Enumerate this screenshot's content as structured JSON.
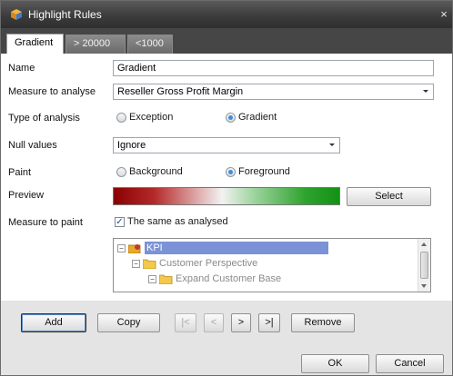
{
  "window": {
    "title": "Highlight Rules",
    "close_glyph": "×",
    "icon": "app-cube-icon"
  },
  "tabs": [
    {
      "label": "Gradient",
      "active": true
    },
    {
      "label": "> 20000",
      "active": false
    },
    {
      "label": "<1000",
      "active": false
    }
  ],
  "form": {
    "name_label": "Name",
    "name_value": "Gradient",
    "measure_label": "Measure to analyse",
    "measure_value": "Reseller Gross Profit Margin",
    "type_label": "Type of analysis",
    "type_options": [
      {
        "label": "Exception",
        "checked": false
      },
      {
        "label": "Gradient",
        "checked": true
      }
    ],
    "null_label": "Null values",
    "null_value": "Ignore",
    "paint_label": "Paint",
    "paint_options": [
      {
        "label": "Background",
        "checked": false
      },
      {
        "label": "Foreground",
        "checked": true
      }
    ],
    "preview_label": "Preview",
    "preview_colors": {
      "start": "#8b0000",
      "middle": "#f2f2f2",
      "end": "#149114"
    },
    "select_label": "Select",
    "paint_measure_label": "Measure to paint",
    "same_as_analysed_label": "The same as analysed",
    "same_as_analysed_checked": true
  },
  "tree": {
    "items": [
      {
        "label": "KPI",
        "selected": true,
        "icon": "kpi-icon"
      },
      {
        "label": "Customer Perspective",
        "icon": "folder-icon"
      },
      {
        "label": "Expand Customer Base",
        "icon": "folder-icon"
      }
    ],
    "selection_color": "#7b93d6"
  },
  "actions": {
    "add": "Add",
    "copy": "Copy",
    "first": "|<",
    "prev": "<",
    "next": ">",
    "last": ">|",
    "remove": "Remove",
    "ok": "OK",
    "cancel": "Cancel"
  }
}
